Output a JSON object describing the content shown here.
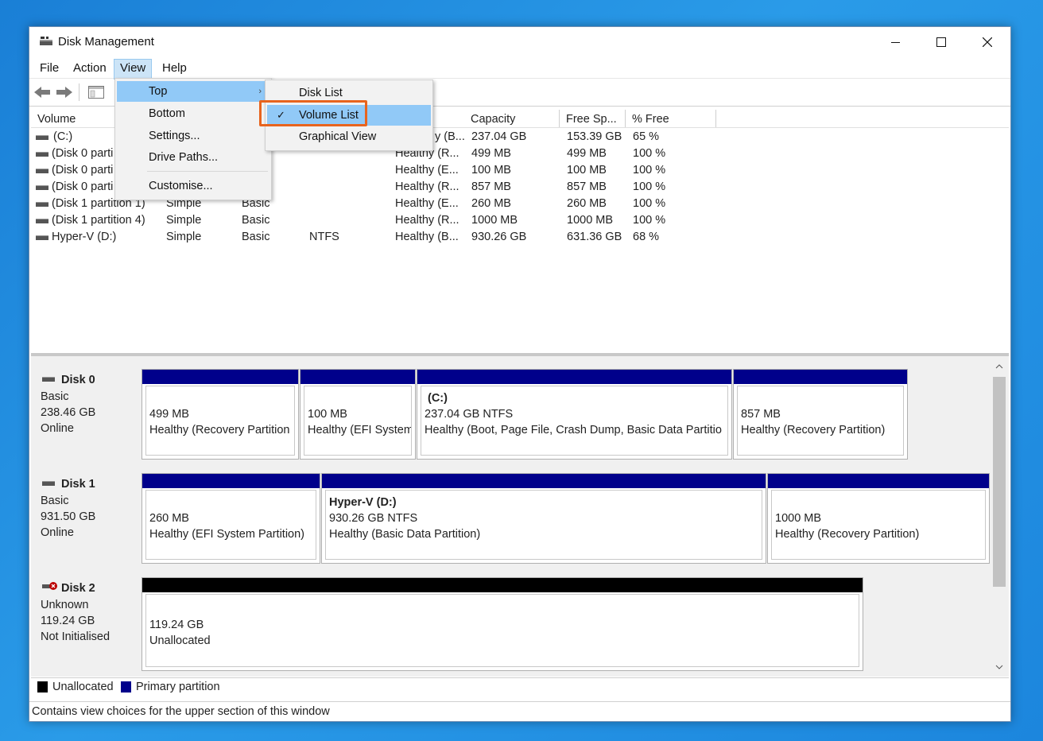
{
  "window": {
    "title": "Disk Management"
  },
  "menubar": [
    "File",
    "Action",
    "View",
    "Help"
  ],
  "view_menu": {
    "items": [
      "Top",
      "Bottom",
      "Settings...",
      "Drive Paths...",
      "Customise..."
    ]
  },
  "submenu": {
    "items": [
      "Disk List",
      "Volume List",
      "Graphical View"
    ],
    "checked": "Volume List"
  },
  "columns": [
    "Volume",
    "Capacity",
    "Free Sp...",
    "% Free"
  ],
  "volumes": [
    {
      "volume": "(C:)",
      "layout": "",
      "type": "",
      "fs": "",
      "status": "y (B...",
      "capacity": "237.04 GB",
      "free": "153.39 GB",
      "pct": "65 %"
    },
    {
      "volume": "(Disk 0 parti",
      "layout": "",
      "type": "",
      "fs": "",
      "status": "Healthy (R...",
      "capacity": "499 MB",
      "free": "499 MB",
      "pct": "100 %"
    },
    {
      "volume": "(Disk 0 parti",
      "layout": "",
      "type": "",
      "fs": "",
      "status": "Healthy (E...",
      "capacity": "100 MB",
      "free": "100 MB",
      "pct": "100 %"
    },
    {
      "volume": "(Disk 0 parti",
      "layout": "",
      "type": "",
      "fs": "",
      "status": "Healthy (R...",
      "capacity": "857 MB",
      "free": "857 MB",
      "pct": "100 %"
    },
    {
      "volume": "(Disk 1 partition 1)",
      "layout": "Simple",
      "type": "Basic",
      "fs": "",
      "status": "Healthy (E...",
      "capacity": "260 MB",
      "free": "260 MB",
      "pct": "100 %"
    },
    {
      "volume": "(Disk 1 partition 4)",
      "layout": "Simple",
      "type": "Basic",
      "fs": "",
      "status": "Healthy (R...",
      "capacity": "1000 MB",
      "free": "1000 MB",
      "pct": "100 %"
    },
    {
      "volume": "Hyper-V (D:)",
      "layout": "Simple",
      "type": "Basic",
      "fs": "NTFS",
      "status": "Healthy (B...",
      "capacity": "930.26 GB",
      "free": "631.36 GB",
      "pct": "68 %"
    }
  ],
  "disks": [
    {
      "name": "Disk 0",
      "type": "Basic",
      "size": "238.46 GB",
      "state": "Online",
      "partitions": [
        {
          "title": "",
          "line1": "499 MB",
          "line2": "Healthy (Recovery Partition"
        },
        {
          "title": "",
          "line1": "100 MB",
          "line2": "Healthy (EFI System"
        },
        {
          "title": "(C:)",
          "line1": "237.04 GB NTFS",
          "line2": "Healthy (Boot, Page File, Crash Dump, Basic Data Partitio"
        },
        {
          "title": "",
          "line1": "857 MB",
          "line2": "Healthy (Recovery Partition)"
        }
      ]
    },
    {
      "name": "Disk 1",
      "type": "Basic",
      "size": "931.50 GB",
      "state": "Online",
      "partitions": [
        {
          "title": "",
          "line1": "260 MB",
          "line2": "Healthy (EFI System Partition)"
        },
        {
          "title": "Hyper-V  (D:)",
          "line1": "930.26 GB NTFS",
          "line2": "Healthy (Basic Data Partition)"
        },
        {
          "title": "",
          "line1": "1000 MB",
          "line2": "Healthy (Recovery Partition)"
        }
      ]
    },
    {
      "name": "Disk 2",
      "type": "Unknown",
      "size": "119.24 GB",
      "state": "Not Initialised",
      "partitions": [
        {
          "title": "",
          "line1": "119.24 GB",
          "line2": "Unallocated"
        }
      ]
    }
  ],
  "legend": {
    "unallocated": "Unallocated",
    "primary": "Primary partition"
  },
  "status_text": "Contains view choices for the upper section of this window",
  "colors": {
    "primary": "#00008b",
    "unallocated": "#000000",
    "highlight_box": "#e8641e",
    "menu_highlight": "#91c9f7"
  }
}
